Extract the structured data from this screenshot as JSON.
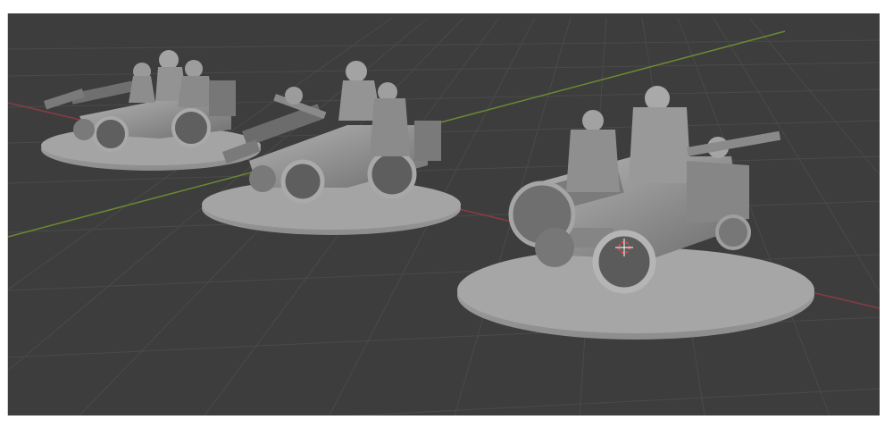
{
  "viewport": {
    "background_color": "#3d3d3d",
    "grid_color": "#4a4a4a",
    "x_axis_color": "#8a3b45",
    "y_axis_color": "#6a8a32",
    "model_color": "#8f8f8f"
  },
  "scene": {
    "objects": [
      {
        "name": "artillery-crew-model-back"
      },
      {
        "name": "artillery-crew-model-middle"
      },
      {
        "name": "artillery-crew-model-front"
      }
    ],
    "origin_marker": "3d-cursor-icon"
  }
}
